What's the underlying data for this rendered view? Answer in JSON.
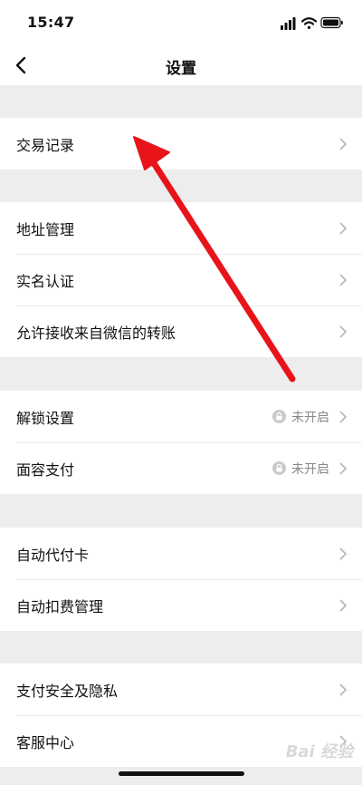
{
  "status_bar": {
    "time": "15:47"
  },
  "nav": {
    "title": "设置"
  },
  "groups": [
    {
      "items": [
        {
          "label": "交易记录"
        }
      ]
    },
    {
      "items": [
        {
          "label": "地址管理"
        },
        {
          "label": "实名认证"
        },
        {
          "label": "允许接收来自微信的转账"
        }
      ]
    },
    {
      "items": [
        {
          "label": "解锁设置",
          "status": "未开启"
        },
        {
          "label": "面容支付",
          "status": "未开启"
        }
      ]
    },
    {
      "items": [
        {
          "label": "自动代付卡"
        },
        {
          "label": "自动扣费管理"
        }
      ]
    },
    {
      "items": [
        {
          "label": "支付安全及隐私"
        },
        {
          "label": "客服中心"
        }
      ]
    }
  ],
  "watermark": "Bai 经验",
  "colors": {
    "annotation_arrow": "#e8141a",
    "background": "#ededed"
  }
}
